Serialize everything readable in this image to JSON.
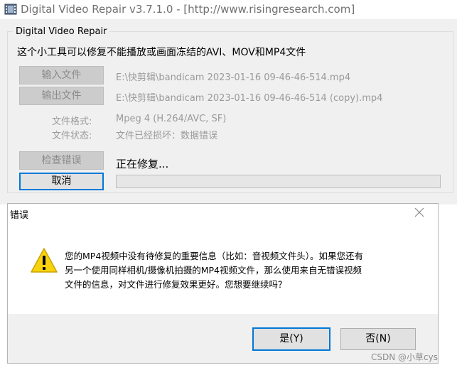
{
  "window": {
    "title": "Digital Video Repair v3.7.1.0 - [http://www.risingresearch.com]"
  },
  "group": {
    "title": "Digital Video Repair",
    "description": "这个小工具可以修复不能播放或画面冻结的AVI、MOV和MP4文件"
  },
  "buttons": {
    "input": "输入文件",
    "output": "输出文件",
    "check": "检查错误",
    "cancel": "取消"
  },
  "files": {
    "input_path": "E:\\快剪辑\\bandicam 2023-01-16 09-46-46-514.mp4",
    "output_path": "E:\\快剪辑\\bandicam 2023-01-16 09-46-46-514 (copy).mp4"
  },
  "info": {
    "format_label": "文件格式:",
    "format_value": "Mpeg 4 (H.264/AVC, SF)",
    "status_label": "文件状态:",
    "status_value": "文件已经损坏：数据错误"
  },
  "progress": {
    "text": "正在修复...",
    "fraction": 0
  },
  "dialog": {
    "title": "错误",
    "message_lines": [
      "您的MP4视频中没有待修复的重要信息（比如：音视频文件头）。如果您还有",
      "另一个使用同样相机/摄像机拍摄的MP4视频文件，那么使用来自无错误视频",
      "文件的信息，对文件进行修复效果更好。您想要继续吗？"
    ],
    "yes_label": "是(Y)",
    "no_label": "否(N)"
  },
  "icons": {
    "app": "film-icon",
    "warning": "warning-icon",
    "close": "close-icon"
  },
  "colors": {
    "warning_yellow": "#f8d20d",
    "focus_blue": "#0078d7",
    "progress_green": "#06b025"
  },
  "watermark": "CSDN @小草cys"
}
